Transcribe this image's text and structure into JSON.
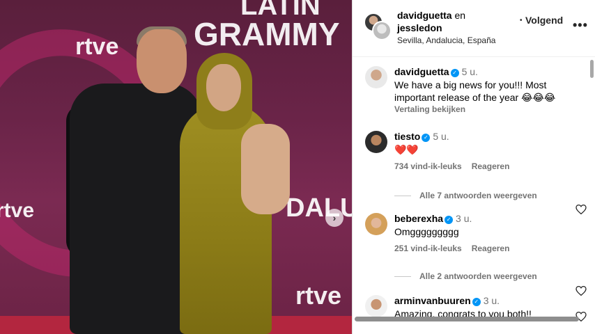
{
  "photo": {
    "wall_texts": [
      "LATIN",
      "GRAMMY",
      "rtve",
      "rtve",
      "rtve",
      "DALU"
    ],
    "next_arrow": "›"
  },
  "post_header": {
    "owner1": "davidguetta",
    "and_word": "en",
    "owner2": "jessledon",
    "follow_dot": "•",
    "follow_status": "Volgend",
    "location": "Sevilla, Andalucia, España",
    "more_icon": "•••"
  },
  "comments": [
    {
      "user": "davidguetta",
      "verified": true,
      "time": "5 u.",
      "text": "We have a big news for you!!! Most important release of the year 😂😂😂",
      "translate": "Vertaling bekijken"
    },
    {
      "user": "tiesto",
      "verified": true,
      "time": "5 u.",
      "text": "❤️❤️",
      "likes": "734 vind-ik-leuks",
      "reply": "Reageren",
      "view_replies": "Alle 7 antwoorden weergeven"
    },
    {
      "user": "beberexha",
      "verified": true,
      "time": "3 u.",
      "text": "Omggggggggg",
      "likes": "251 vind-ik-leuks",
      "reply": "Reageren",
      "view_replies": "Alle 2 antwoorden weergeven"
    },
    {
      "user": "arminvanbuuren",
      "verified": true,
      "time": "3 u.",
      "text": "Amazing, congrats to you both!!"
    }
  ],
  "colors": {
    "verified": "#0095f6",
    "secondary_text": "#737373",
    "heart_red": "#ed4956"
  },
  "icons": {
    "verified": "verified-badge-icon",
    "heart": "heart-icon",
    "more": "more-options-icon",
    "next": "chevron-right-icon"
  }
}
